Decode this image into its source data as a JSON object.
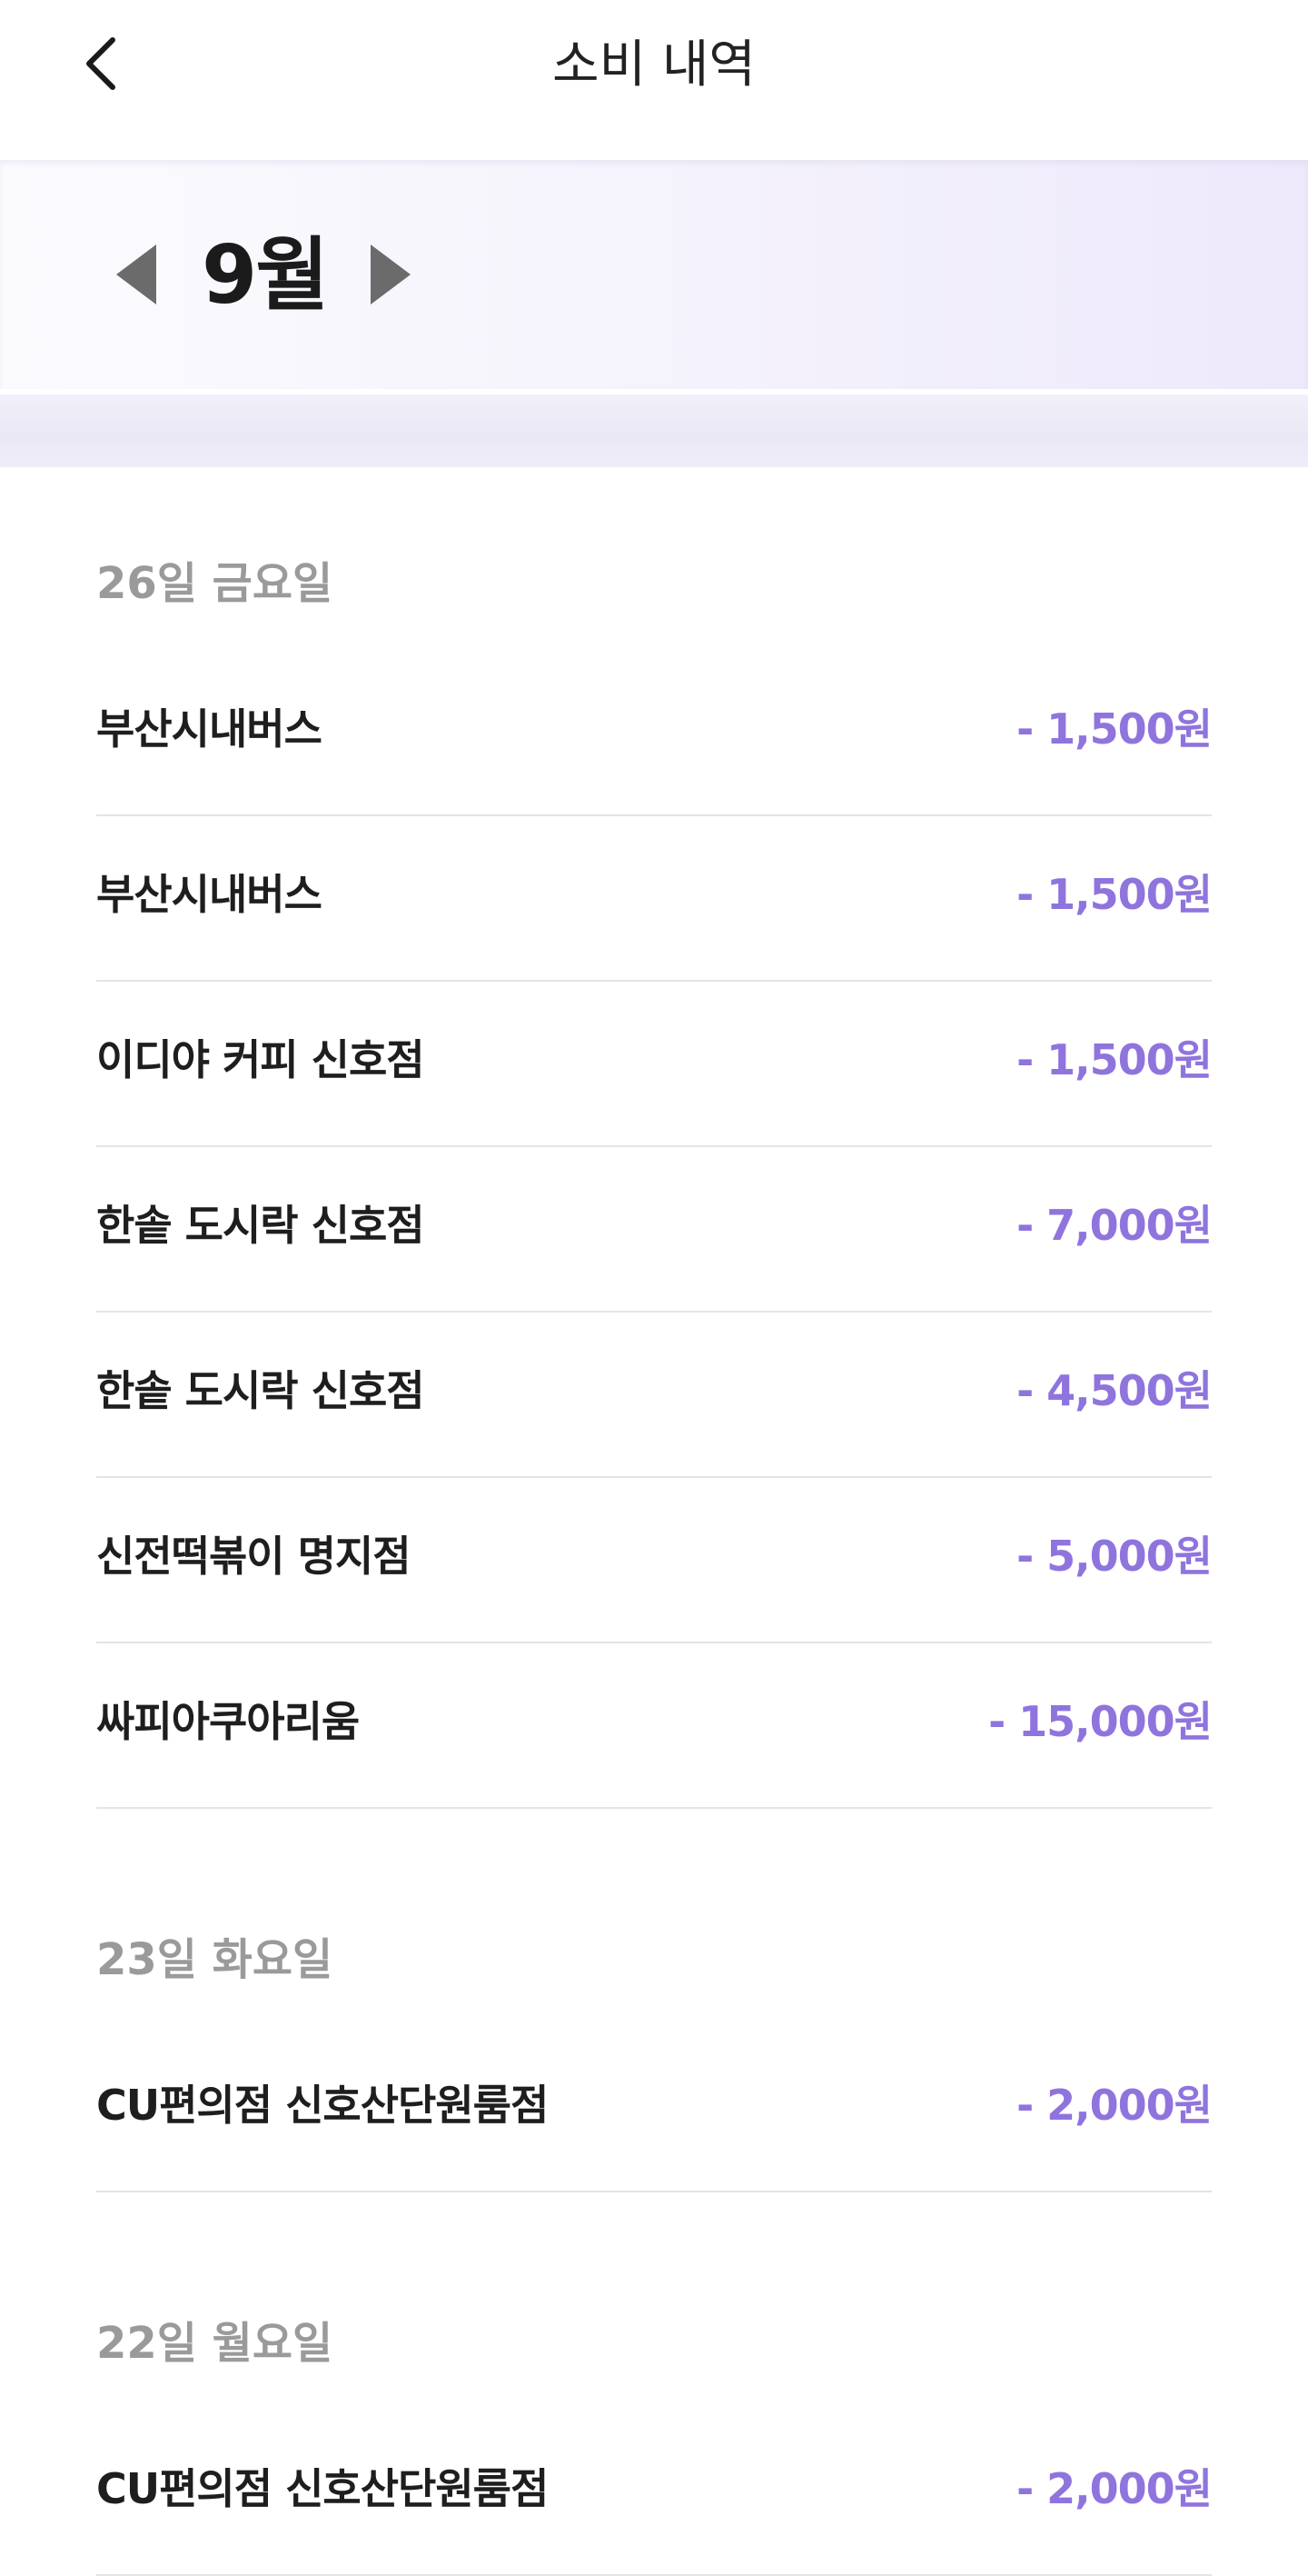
{
  "header": {
    "title": "소비 내역",
    "back_icon": "chevron-left-icon"
  },
  "month_nav": {
    "label": "9월",
    "prev_icon": "triangle-left-icon",
    "next_icon": "triangle-right-icon",
    "arrow_color": "#6b6b6b"
  },
  "colors": {
    "amount": "#8f74dd",
    "date": "#9a9a9a",
    "divider": "#e4e4e4"
  },
  "groups": [
    {
      "date": "26일 금요일",
      "items": [
        {
          "merchant": "부산시내버스",
          "amount": "- 1,500원"
        },
        {
          "merchant": "부산시내버스",
          "amount": "- 1,500원"
        },
        {
          "merchant": "이디야 커피 신호점",
          "amount": "- 1,500원"
        },
        {
          "merchant": "한솥 도시락 신호점",
          "amount": "- 7,000원"
        },
        {
          "merchant": "한솥 도시락 신호점",
          "amount": "- 4,500원"
        },
        {
          "merchant": "신전떡볶이 명지점",
          "amount": "- 5,000원"
        },
        {
          "merchant": "싸피아쿠아리움",
          "amount": "- 15,000원"
        }
      ]
    },
    {
      "date": "23일 화요일",
      "items": [
        {
          "merchant": "CU편의점 신호산단원룸점",
          "amount": "- 2,000원"
        }
      ]
    },
    {
      "date": "22일 월요일",
      "items": [
        {
          "merchant": "CU편의점 신호산단원룸점",
          "amount": "- 2,000원"
        }
      ]
    }
  ]
}
